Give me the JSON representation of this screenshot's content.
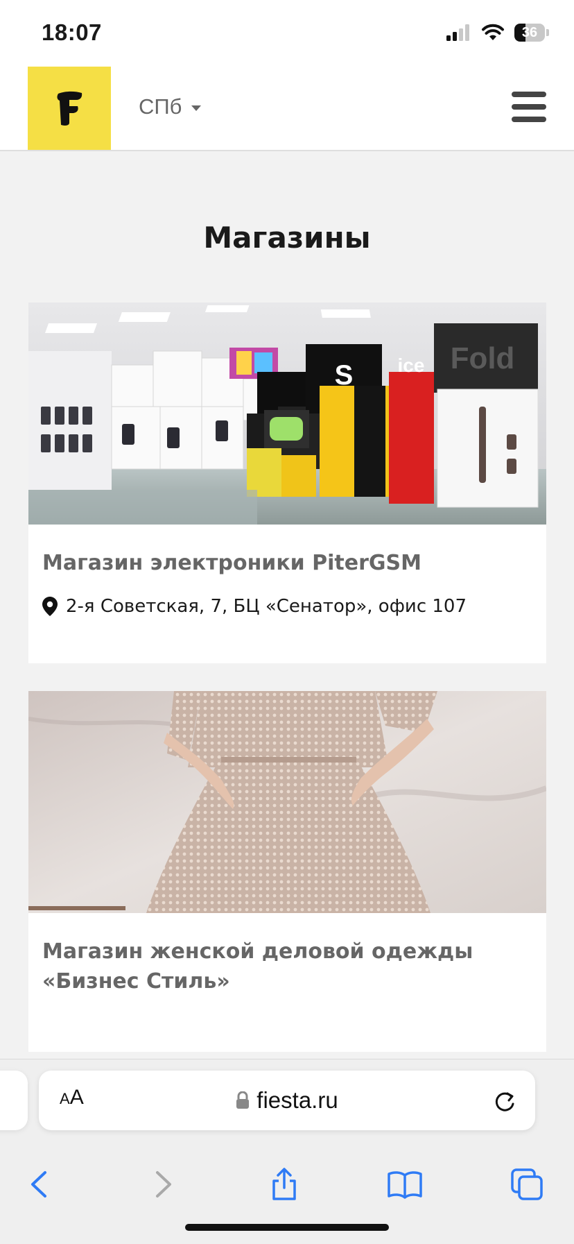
{
  "status_bar": {
    "time": "18:07",
    "battery_level": "36",
    "battery_fraction": 0.36,
    "icons": [
      "cellular-signal-icon",
      "wifi-icon",
      "battery-icon"
    ]
  },
  "header": {
    "logo_letter": "F",
    "logo_color": "#f5df45",
    "city": "СПб",
    "icons": [
      "dropdown-caret-icon",
      "hamburger-menu-icon"
    ]
  },
  "main": {
    "title": "Магазины",
    "stores": [
      {
        "name": "Магазин электроники PiterGSM",
        "address": "2-я Советская, 7, БЦ «Сенатор», офис 107",
        "image": "electronics-store-photo"
      },
      {
        "name": "Магазин женской деловой одежды «Бизнес Стиль»",
        "address": "",
        "image": "business-dress-photo"
      }
    ]
  },
  "browser": {
    "text_size_small": "A",
    "text_size_big": "A",
    "url": "fiesta.ru",
    "accent_color": "#2f7bf5",
    "toolbar_icons": [
      "back-icon",
      "forward-icon",
      "share-icon",
      "bookmarks-icon",
      "tabs-icon"
    ]
  }
}
